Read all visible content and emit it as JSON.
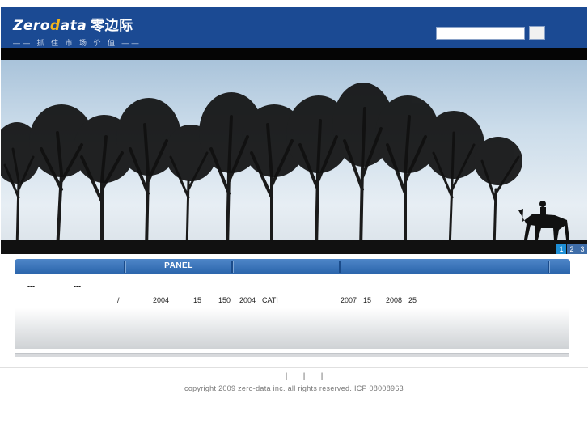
{
  "header": {
    "logo_part1": "Zero",
    "logo_part2": "d",
    "logo_part3": "ata",
    "logo_cn": "零边际",
    "tagline": "—— 抓 住 市 场 价 值 ——",
    "search_placeholder": ""
  },
  "banner": {
    "pages": [
      "1",
      "2",
      "3"
    ],
    "active_page": "1"
  },
  "panel": {
    "tab_title": "PANEL",
    "row1": {
      "a": "---",
      "b": "---"
    },
    "row2": [
      "/",
      "2004",
      "15",
      "150",
      "2004",
      "CATI",
      "2007",
      "15",
      "2008",
      "25"
    ]
  },
  "footer": {
    "links": [
      "|",
      "|",
      "|"
    ],
    "copyright": "copyright 2009 zero-data inc. all rights reserved.   ICP 08008963"
  },
  "colors": {
    "header_bg": "#1b4a93",
    "accent": "#f3b41a",
    "tab_bar": "#3a74bb",
    "nav_bar": "#050505"
  }
}
